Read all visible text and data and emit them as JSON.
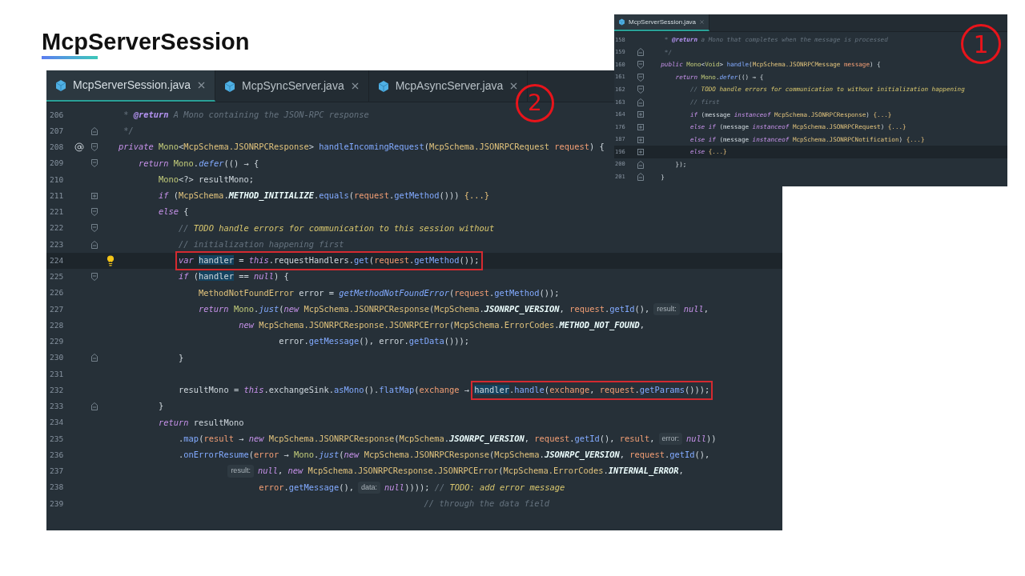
{
  "slide": {
    "title": "McpServerSession"
  },
  "small_editor": {
    "callout": "1",
    "tabs": [
      {
        "label": "McpServerSession.java",
        "selected": true
      }
    ],
    "lines": [
      {
        "number": "158",
        "current": false,
        "segments": [
          {
            "kind": "code",
            "tokens": [
              {
                "text": "     * ",
                "kind": "cm"
              },
              {
                "text": "@return",
                "kind": "doc"
              },
              {
                "text": " a Mono that completes when the message is processed",
                "kind": "cm"
              }
            ]
          }
        ]
      },
      {
        "number": "159",
        "current": false,
        "fold_marker": {
          "kind": "close"
        },
        "segments": [
          {
            "kind": "code",
            "tokens": [
              {
                "text": "     */",
                "kind": "cm"
              }
            ]
          }
        ]
      },
      {
        "number": "160",
        "current": false,
        "fold_marker": {
          "kind": "open"
        },
        "segments": [
          {
            "kind": "code",
            "tokens": [
              {
                "text": "    public ",
                "kind": "kw"
              },
              {
                "text": "Mono",
                "kind": "type"
              },
              {
                "text": "<",
                "kind": "plain"
              },
              {
                "text": "Void",
                "kind": "type"
              },
              {
                "text": "> ",
                "kind": "plain"
              },
              {
                "text": "handle",
                "kind": "fn"
              },
              {
                "text": "(",
                "kind": "plain"
              },
              {
                "text": "McpSchema.",
                "kind": "cls"
              },
              {
                "text": "JSONRPCMessage",
                "kind": "cls"
              },
              {
                "text": " message",
                "kind": "param"
              },
              {
                "text": ") {",
                "kind": "plain"
              }
            ]
          }
        ]
      },
      {
        "number": "161",
        "current": false,
        "fold_marker": {
          "kind": "open"
        },
        "segments": [
          {
            "kind": "code",
            "tokens": [
              {
                "text": "        return ",
                "kind": "kw"
              },
              {
                "text": "Mono",
                "kind": "type"
              },
              {
                "text": ".",
                "kind": "plain"
              },
              {
                "text": "defer",
                "kind": "sfn"
              },
              {
                "text": "(() → {",
                "kind": "plain"
              }
            ]
          }
        ]
      },
      {
        "number": "162",
        "current": false,
        "fold_marker": {
          "kind": "open"
        },
        "segments": [
          {
            "kind": "code",
            "tokens": [
              {
                "text": "            // ",
                "kind": "cm"
              },
              {
                "text": "TODO handle errors for communication to without initialization happening",
                "kind": "todo"
              }
            ]
          }
        ]
      },
      {
        "number": "163",
        "current": false,
        "fold_marker": {
          "kind": "close"
        },
        "segments": [
          {
            "kind": "code",
            "tokens": [
              {
                "text": "            // first",
                "kind": "cm"
              }
            ]
          }
        ]
      },
      {
        "number": "164",
        "current": false,
        "fold_marker": {
          "kind": "collapsed"
        },
        "segments": [
          {
            "kind": "code",
            "tokens": [
              {
                "text": "            if",
                "kind": "kw"
              },
              {
                "text": " (message ",
                "kind": "plain"
              },
              {
                "text": "instanceof",
                "kind": "kw"
              },
              {
                "text": " McpSchema.JSONRPCResponse",
                "kind": "cls"
              },
              {
                "text": ") ",
                "kind": "plain"
              },
              {
                "text": "{...}",
                "kind": "folded"
              }
            ]
          }
        ]
      },
      {
        "number": "176",
        "current": false,
        "fold_marker": {
          "kind": "collapsed"
        },
        "segments": [
          {
            "kind": "code",
            "tokens": [
              {
                "text": "            else if",
                "kind": "kw"
              },
              {
                "text": " (message ",
                "kind": "plain"
              },
              {
                "text": "instanceof",
                "kind": "kw"
              },
              {
                "text": " McpSchema.JSONRPCRequest",
                "kind": "cls"
              },
              {
                "text": ") ",
                "kind": "plain"
              },
              {
                "text": "{...}",
                "kind": "folded"
              }
            ]
          }
        ]
      },
      {
        "number": "187",
        "current": false,
        "fold_marker": {
          "kind": "collapsed"
        },
        "segments": [
          {
            "kind": "code",
            "tokens": [
              {
                "text": "            else if",
                "kind": "kw"
              },
              {
                "text": " (message ",
                "kind": "plain"
              },
              {
                "text": "instanceof",
                "kind": "kw"
              },
              {
                "text": " McpSchema.JSONRPCNotification",
                "kind": "cls"
              },
              {
                "text": ") ",
                "kind": "plain"
              },
              {
                "text": "{...}",
                "kind": "folded"
              }
            ]
          }
        ]
      },
      {
        "number": "196",
        "current": true,
        "fold_marker": {
          "kind": "collapsed"
        },
        "segments": [
          {
            "kind": "code",
            "tokens": [
              {
                "text": "            else ",
                "kind": "kw"
              },
              {
                "text": "{...}",
                "kind": "folded"
              }
            ]
          }
        ]
      },
      {
        "number": "200",
        "current": false,
        "fold_marker": {
          "kind": "close"
        },
        "segments": [
          {
            "kind": "code",
            "tokens": [
              {
                "text": "        });",
                "kind": "plain"
              }
            ]
          }
        ]
      },
      {
        "number": "201",
        "current": false,
        "fold_marker": {
          "kind": "close"
        },
        "segments": [
          {
            "kind": "code",
            "tokens": [
              {
                "text": "    }",
                "kind": "plain"
              }
            ]
          }
        ]
      }
    ]
  },
  "main_editor": {
    "callout": "2",
    "tabs": [
      {
        "label": "McpServerSession.java",
        "selected": true
      },
      {
        "label": "McpSyncServer.java",
        "selected": false
      },
      {
        "label": "McpAsyncServer.java",
        "selected": false
      }
    ],
    "lines": [
      {
        "number": "206",
        "current": false,
        "segments": [
          {
            "kind": "code",
            "tokens": [
              {
                "text": " * ",
                "kind": "cm"
              },
              {
                "text": "@return",
                "kind": "doc"
              },
              {
                "text": " A Mono containing the JSON-RPC response",
                "kind": "cm"
              }
            ]
          }
        ]
      },
      {
        "number": "207",
        "current": false,
        "fold_marker": {
          "kind": "close"
        },
        "segments": [
          {
            "kind": "code",
            "tokens": [
              {
                "text": " */",
                "kind": "cm"
              }
            ]
          }
        ]
      },
      {
        "number": "208",
        "current": false,
        "fold_marker": {
          "kind": "open"
        },
        "gutter_mark": {
          "kind": "annotation"
        },
        "segments": [
          {
            "kind": "code",
            "tokens": [
              {
                "text": "private ",
                "kind": "kw"
              },
              {
                "text": "Mono",
                "kind": "type"
              },
              {
                "text": "<",
                "kind": "plain"
              },
              {
                "text": "McpSchema.JSONRPCResponse",
                "kind": "cls"
              },
              {
                "text": "> ",
                "kind": "plain"
              },
              {
                "text": "handleIncomingRequest",
                "kind": "fn"
              },
              {
                "text": "(",
                "kind": "plain"
              },
              {
                "text": "McpSchema.JSONRPCRequest",
                "kind": "cls"
              },
              {
                "text": " request",
                "kind": "param"
              },
              {
                "text": ") {",
                "kind": "plain"
              }
            ]
          }
        ]
      },
      {
        "number": "209",
        "current": false,
        "fold_marker": {
          "kind": "open"
        },
        "segments": [
          {
            "kind": "code",
            "tokens": [
              {
                "text": "    return ",
                "kind": "kw"
              },
              {
                "text": "Mono",
                "kind": "type"
              },
              {
                "text": ".",
                "kind": "plain"
              },
              {
                "text": "defer",
                "kind": "sfn"
              },
              {
                "text": "(() → {",
                "kind": "plain"
              }
            ]
          }
        ]
      },
      {
        "number": "210",
        "current": false,
        "segments": [
          {
            "kind": "code",
            "tokens": [
              {
                "text": "        Mono",
                "kind": "type"
              },
              {
                "text": "<?> resultMono;",
                "kind": "plain"
              }
            ]
          }
        ]
      },
      {
        "number": "211",
        "current": false,
        "fold_marker": {
          "kind": "collapsed"
        },
        "segments": [
          {
            "kind": "code",
            "tokens": [
              {
                "text": "        if",
                "kind": "kw"
              },
              {
                "text": " (",
                "kind": "plain"
              },
              {
                "text": "McpSchema",
                "kind": "cls"
              },
              {
                "text": ".",
                "kind": "plain"
              },
              {
                "text": "METHOD_INITIALIZE",
                "kind": "const"
              },
              {
                "text": ".",
                "kind": "plain"
              },
              {
                "text": "equals",
                "kind": "fn"
              },
              {
                "text": "(",
                "kind": "plain"
              },
              {
                "text": "request",
                "kind": "param"
              },
              {
                "text": ".",
                "kind": "plain"
              },
              {
                "text": "getMethod",
                "kind": "fn"
              },
              {
                "text": "())) ",
                "kind": "plain"
              },
              {
                "text": "{...}",
                "kind": "folded"
              }
            ]
          }
        ]
      },
      {
        "number": "221",
        "current": false,
        "fold_marker": {
          "kind": "open"
        },
        "segments": [
          {
            "kind": "code",
            "tokens": [
              {
                "text": "        else",
                "kind": "kw"
              },
              {
                "text": " {",
                "kind": "plain"
              }
            ]
          }
        ]
      },
      {
        "number": "222",
        "current": false,
        "fold_marker": {
          "kind": "open"
        },
        "segments": [
          {
            "kind": "code",
            "tokens": [
              {
                "text": "            // ",
                "kind": "cm"
              },
              {
                "text": "TODO handle errors for communication to this session without",
                "kind": "todo"
              }
            ]
          }
        ]
      },
      {
        "number": "223",
        "current": false,
        "fold_marker": {
          "kind": "close"
        },
        "segments": [
          {
            "kind": "code",
            "tokens": [
              {
                "text": "            // initialization happening first",
                "kind": "cm"
              }
            ]
          }
        ]
      },
      {
        "number": "224",
        "current": true,
        "gutter_mark": {
          "kind": "bulb"
        },
        "segments": [
          {
            "kind": "boxed",
            "tokens": [
              {
                "text": "            var ",
                "kind": "kw"
              },
              {
                "text": "handler",
                "kind": "occurrence"
              },
              {
                "text": " = ",
                "kind": "plain"
              },
              {
                "text": "this",
                "kind": "kw"
              },
              {
                "text": ".requestHandlers.",
                "kind": "plain"
              },
              {
                "text": "get",
                "kind": "fn"
              },
              {
                "text": "(",
                "kind": "plain"
              },
              {
                "text": "request",
                "kind": "param"
              },
              {
                "text": ".",
                "kind": "plain"
              },
              {
                "text": "getMethod",
                "kind": "fn"
              },
              {
                "text": "());",
                "kind": "plain"
              }
            ]
          }
        ]
      },
      {
        "number": "225",
        "current": false,
        "fold_marker": {
          "kind": "open"
        },
        "segments": [
          {
            "kind": "code",
            "tokens": [
              {
                "text": "            if",
                "kind": "kw"
              },
              {
                "text": " (",
                "kind": "plain"
              },
              {
                "text": "handler",
                "kind": "occurrence"
              },
              {
                "text": " == ",
                "kind": "plain"
              },
              {
                "text": "null",
                "kind": "kw"
              },
              {
                "text": ") {",
                "kind": "plain"
              }
            ]
          }
        ]
      },
      {
        "number": "226",
        "current": false,
        "segments": [
          {
            "kind": "code",
            "tokens": [
              {
                "text": "                MethodNotFoundError",
                "kind": "cls"
              },
              {
                "text": " error = ",
                "kind": "plain"
              },
              {
                "text": "getMethodNotFoundError",
                "kind": "sfn"
              },
              {
                "text": "(",
                "kind": "plain"
              },
              {
                "text": "request",
                "kind": "param"
              },
              {
                "text": ".",
                "kind": "plain"
              },
              {
                "text": "getMethod",
                "kind": "fn"
              },
              {
                "text": "());",
                "kind": "plain"
              }
            ]
          }
        ]
      },
      {
        "number": "227",
        "current": false,
        "segments": [
          {
            "kind": "code",
            "tokens": [
              {
                "text": "                return ",
                "kind": "kw"
              },
              {
                "text": "Mono",
                "kind": "type"
              },
              {
                "text": ".",
                "kind": "plain"
              },
              {
                "text": "just",
                "kind": "sfn"
              },
              {
                "text": "(",
                "kind": "plain"
              },
              {
                "text": "new ",
                "kind": "kw"
              },
              {
                "text": "McpSchema.JSONRPCResponse",
                "kind": "cls"
              },
              {
                "text": "(",
                "kind": "plain"
              },
              {
                "text": "McpSchema",
                "kind": "cls"
              },
              {
                "text": ".",
                "kind": "plain"
              },
              {
                "text": "JSONRPC_VERSION",
                "kind": "const"
              },
              {
                "text": ", ",
                "kind": "plain"
              },
              {
                "text": "request",
                "kind": "param"
              },
              {
                "text": ".",
                "kind": "plain"
              },
              {
                "text": "getId",
                "kind": "fn"
              },
              {
                "text": "(),",
                "kind": "plain"
              }
            ]
          },
          {
            "kind": "hint",
            "text": "result:"
          },
          {
            "kind": "code",
            "tokens": [
              {
                "text": "null",
                "kind": "kw"
              },
              {
                "text": ",",
                "kind": "plain"
              }
            ]
          }
        ]
      },
      {
        "number": "228",
        "current": false,
        "segments": [
          {
            "kind": "code",
            "tokens": [
              {
                "text": "                        new ",
                "kind": "kw"
              },
              {
                "text": "McpSchema.JSONRPCResponse.JSONRPCError",
                "kind": "cls"
              },
              {
                "text": "(",
                "kind": "plain"
              },
              {
                "text": "McpSchema.ErrorCodes",
                "kind": "cls"
              },
              {
                "text": ".",
                "kind": "plain"
              },
              {
                "text": "METHOD_NOT_FOUND",
                "kind": "const"
              },
              {
                "text": ",",
                "kind": "plain"
              }
            ]
          }
        ]
      },
      {
        "number": "229",
        "current": false,
        "segments": [
          {
            "kind": "code",
            "tokens": [
              {
                "text": "                                error.",
                "kind": "plain"
              },
              {
                "text": "getMessage",
                "kind": "fn"
              },
              {
                "text": "(), error.",
                "kind": "plain"
              },
              {
                "text": "getData",
                "kind": "fn"
              },
              {
                "text": "()));",
                "kind": "plain"
              }
            ]
          }
        ]
      },
      {
        "number": "230",
        "current": false,
        "fold_marker": {
          "kind": "close"
        },
        "segments": [
          {
            "kind": "code",
            "tokens": [
              {
                "text": "            }",
                "kind": "plain"
              }
            ]
          }
        ]
      },
      {
        "number": "231",
        "current": false
      },
      {
        "number": "232",
        "current": false,
        "segments": [
          {
            "kind": "code",
            "tokens": [
              {
                "text": "            resultMono = ",
                "kind": "plain"
              },
              {
                "text": "this",
                "kind": "kw"
              },
              {
                "text": ".exchangeSink.",
                "kind": "plain"
              },
              {
                "text": "asMono",
                "kind": "fn"
              },
              {
                "text": "().",
                "kind": "plain"
              },
              {
                "text": "flatMap",
                "kind": "fn"
              },
              {
                "text": "(",
                "kind": "plain"
              },
              {
                "text": "exchange",
                "kind": "param"
              },
              {
                "text": " →",
                "kind": "plain"
              }
            ]
          },
          {
            "kind": "boxed",
            "tokens": [
              {
                "text": " handler",
                "kind": "occurrence"
              },
              {
                "text": ".",
                "kind": "plain"
              },
              {
                "text": "handle",
                "kind": "fn"
              },
              {
                "text": "(",
                "kind": "plain"
              },
              {
                "text": "exchange",
                "kind": "param"
              },
              {
                "text": ", ",
                "kind": "plain"
              },
              {
                "text": "request",
                "kind": "param"
              },
              {
                "text": ".",
                "kind": "plain"
              },
              {
                "text": "getParams",
                "kind": "fn"
              },
              {
                "text": "()));",
                "kind": "plain"
              }
            ]
          }
        ]
      },
      {
        "number": "233",
        "current": false,
        "fold_marker": {
          "kind": "close"
        },
        "segments": [
          {
            "kind": "code",
            "tokens": [
              {
                "text": "        }",
                "kind": "plain"
              }
            ]
          }
        ]
      },
      {
        "number": "234",
        "current": false,
        "segments": [
          {
            "kind": "code",
            "tokens": [
              {
                "text": "        return",
                "kind": "kw"
              },
              {
                "text": " resultMono",
                "kind": "plain"
              }
            ]
          }
        ]
      },
      {
        "number": "235",
        "current": false,
        "segments": [
          {
            "kind": "code",
            "tokens": [
              {
                "text": "            .",
                "kind": "plain"
              },
              {
                "text": "map",
                "kind": "fn"
              },
              {
                "text": "(",
                "kind": "plain"
              },
              {
                "text": "result",
                "kind": "param"
              },
              {
                "text": " → ",
                "kind": "plain"
              },
              {
                "text": "new ",
                "kind": "kw"
              },
              {
                "text": "McpSchema.JSONRPCResponse",
                "kind": "cls"
              },
              {
                "text": "(",
                "kind": "plain"
              },
              {
                "text": "McpSchema",
                "kind": "cls"
              },
              {
                "text": ".",
                "kind": "plain"
              },
              {
                "text": "JSONRPC_VERSION",
                "kind": "const"
              },
              {
                "text": ", ",
                "kind": "plain"
              },
              {
                "text": "request",
                "kind": "param"
              },
              {
                "text": ".",
                "kind": "plain"
              },
              {
                "text": "getId",
                "kind": "fn"
              },
              {
                "text": "(), ",
                "kind": "plain"
              },
              {
                "text": "result",
                "kind": "param"
              },
              {
                "text": ",",
                "kind": "plain"
              }
            ]
          },
          {
            "kind": "hint",
            "text": "error:"
          },
          {
            "kind": "code",
            "tokens": [
              {
                "text": "null",
                "kind": "kw"
              },
              {
                "text": "))",
                "kind": "plain"
              }
            ]
          }
        ]
      },
      {
        "number": "236",
        "current": false,
        "segments": [
          {
            "kind": "code",
            "tokens": [
              {
                "text": "            .",
                "kind": "plain"
              },
              {
                "text": "onErrorResume",
                "kind": "fn"
              },
              {
                "text": "(",
                "kind": "plain"
              },
              {
                "text": "error",
                "kind": "param"
              },
              {
                "text": " → ",
                "kind": "plain"
              },
              {
                "text": "Mono",
                "kind": "type"
              },
              {
                "text": ".",
                "kind": "plain"
              },
              {
                "text": "just",
                "kind": "sfn"
              },
              {
                "text": "(",
                "kind": "plain"
              },
              {
                "text": "new ",
                "kind": "kw"
              },
              {
                "text": "McpSchema.JSONRPCResponse",
                "kind": "cls"
              },
              {
                "text": "(",
                "kind": "plain"
              },
              {
                "text": "McpSchema",
                "kind": "cls"
              },
              {
                "text": ".",
                "kind": "plain"
              },
              {
                "text": "JSONRPC_VERSION",
                "kind": "const"
              },
              {
                "text": ", ",
                "kind": "plain"
              },
              {
                "text": "request",
                "kind": "param"
              },
              {
                "text": ".",
                "kind": "plain"
              },
              {
                "text": "getId",
                "kind": "fn"
              },
              {
                "text": "(),",
                "kind": "plain"
              }
            ]
          }
        ]
      },
      {
        "number": "237",
        "current": false,
        "segments": [
          {
            "kind": "hint",
            "text": "                     result:"
          },
          {
            "kind": "code",
            "tokens": [
              {
                "text": "null",
                "kind": "kw"
              },
              {
                "text": ", ",
                "kind": "plain"
              },
              {
                "text": "new ",
                "kind": "kw"
              },
              {
                "text": "McpSchema.JSONRPCResponse.JSONRPCError",
                "kind": "cls"
              },
              {
                "text": "(",
                "kind": "plain"
              },
              {
                "text": "McpSchema.ErrorCodes",
                "kind": "cls"
              },
              {
                "text": ".",
                "kind": "plain"
              },
              {
                "text": "INTERNAL_ERROR",
                "kind": "const"
              },
              {
                "text": ",",
                "kind": "plain"
              }
            ]
          }
        ]
      },
      {
        "number": "238",
        "current": false,
        "segments": [
          {
            "kind": "code",
            "tokens": [
              {
                "text": "                            error",
                "kind": "param"
              },
              {
                "text": ".",
                "kind": "plain"
              },
              {
                "text": "getMessage",
                "kind": "fn"
              },
              {
                "text": "(),",
                "kind": "plain"
              }
            ]
          },
          {
            "kind": "hint",
            "text": "data:"
          },
          {
            "kind": "code",
            "tokens": [
              {
                "text": "null",
                "kind": "kw"
              },
              {
                "text": ")))); ",
                "kind": "plain"
              },
              {
                "text": "// ",
                "kind": "cm"
              },
              {
                "text": "TODO: add error message",
                "kind": "todo"
              }
            ]
          }
        ]
      },
      {
        "number": "239",
        "current": false,
        "segments": [
          {
            "kind": "code",
            "tokens": [
              {
                "text": "                                                             // through the data field",
                "kind": "cm"
              }
            ]
          }
        ]
      }
    ]
  }
}
